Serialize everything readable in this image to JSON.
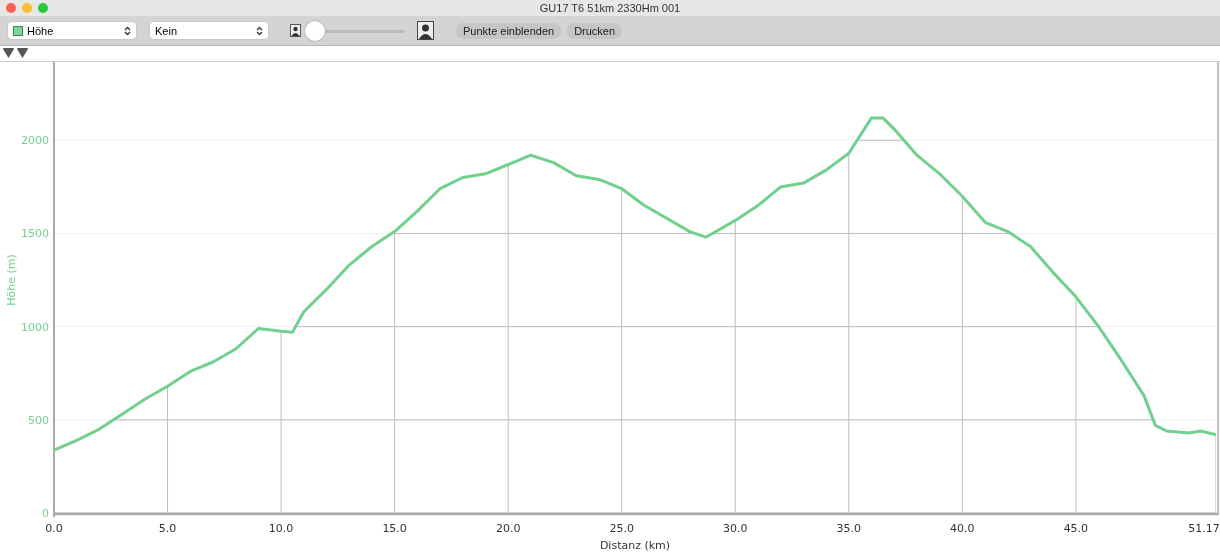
{
  "window": {
    "title": "GU17 T6 51km 2330Hm 001"
  },
  "toolbar": {
    "selects": [
      {
        "value": "Höhe",
        "color": "#7fd49a"
      },
      {
        "value": "Kein"
      }
    ],
    "slider": {
      "level": 0.0
    },
    "buttons": [
      "Punkte einblenden",
      "Drucken"
    ]
  },
  "chart": {
    "chart_data": {
      "type": "line",
      "xlabel": "Distanz (km)",
      "ylabel": "Höhe (m)",
      "xlim": [
        0,
        51.17
      ],
      "ylim": [
        0,
        2420
      ],
      "grid": true,
      "xticks": [
        {
          "value": 0,
          "label": "0.0"
        },
        {
          "value": 5,
          "label": "5.0"
        },
        {
          "value": 10,
          "label": "10.0"
        },
        {
          "value": 15,
          "label": "15.0"
        },
        {
          "value": 20,
          "label": "20.0"
        },
        {
          "value": 25,
          "label": "25.0"
        },
        {
          "value": 30,
          "label": "30.0"
        },
        {
          "value": 35,
          "label": "35.0"
        },
        {
          "value": 40,
          "label": "40.0"
        },
        {
          "value": 45,
          "label": "45.0"
        },
        {
          "value": 51.17,
          "label": "51.17"
        }
      ],
      "yticks": [
        0,
        500,
        1000,
        1500,
        2000
      ],
      "x": [
        0,
        1,
        2,
        3,
        4,
        5,
        6,
        7,
        8,
        9,
        10,
        10.5,
        11,
        12,
        13,
        14,
        15,
        16,
        17,
        18,
        19,
        20,
        21,
        22,
        23,
        24,
        25,
        26,
        27,
        28,
        28.7,
        29,
        30,
        31,
        32,
        33,
        34,
        35,
        36,
        36.5,
        37,
        38,
        39,
        40,
        41,
        42,
        43,
        44,
        45,
        46,
        47,
        48,
        48.5,
        49,
        50,
        50.5,
        51.17
      ],
      "series": [
        {
          "color": "#72d08e",
          "values": [
            337,
            390,
            450,
            530,
            610,
            680,
            760,
            810,
            880,
            990,
            975,
            970,
            1080,
            1200,
            1330,
            1430,
            1510,
            1620,
            1740,
            1800,
            1820,
            1870,
            1920,
            1880,
            1810,
            1790,
            1740,
            1650,
            1580,
            1510,
            1480,
            1500,
            1570,
            1650,
            1750,
            1770,
            1840,
            1930,
            2120,
            2120,
            2060,
            1920,
            1820,
            1700,
            1560,
            1510,
            1430,
            1290,
            1160,
            1000,
            820,
            630,
            470,
            440,
            430,
            440,
            420
          ]
        }
      ]
    }
  }
}
